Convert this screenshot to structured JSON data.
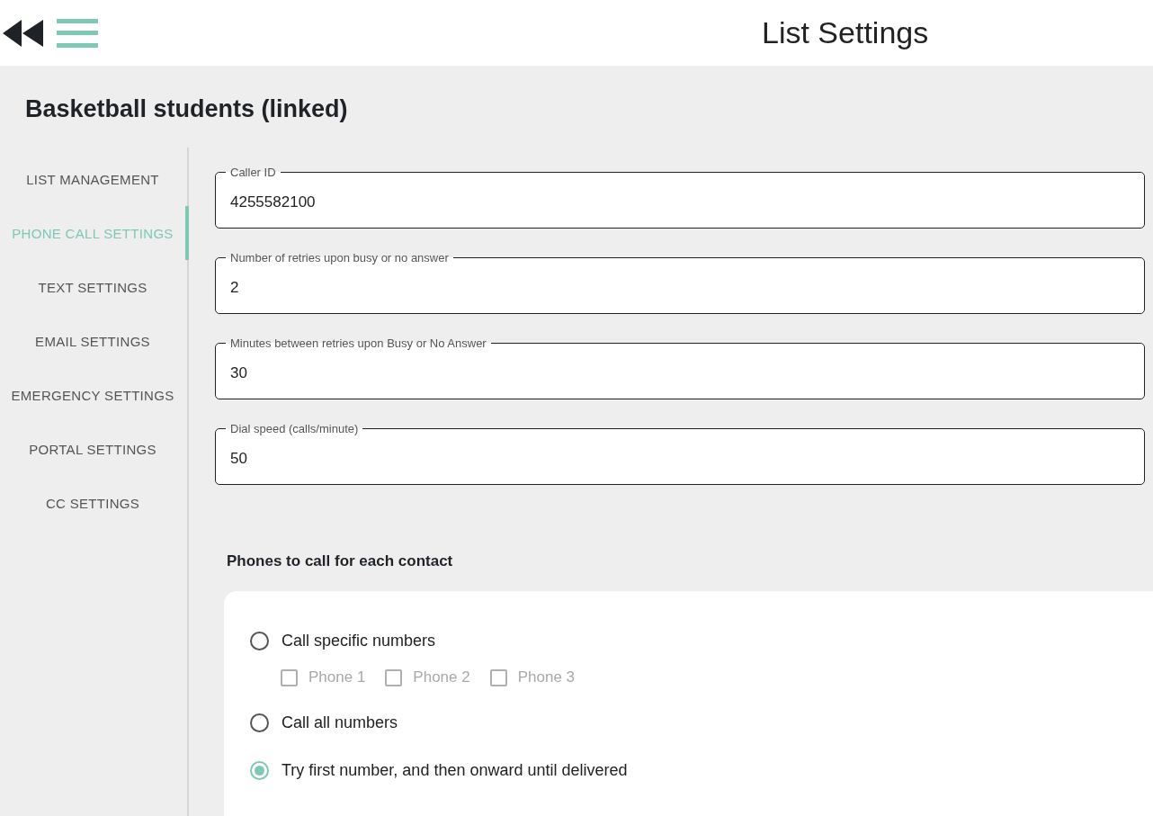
{
  "header": {
    "title": "List Settings"
  },
  "list_title": "Basketball students (linked)",
  "sidebar": {
    "items": [
      {
        "label": "LIST MANAGEMENT",
        "selected": false
      },
      {
        "label": "PHONE CALL SETTINGS",
        "selected": true
      },
      {
        "label": "TEXT SETTINGS",
        "selected": false
      },
      {
        "label": "EMAIL SETTINGS",
        "selected": false
      },
      {
        "label": "EMERGENCY SETTINGS",
        "selected": false
      },
      {
        "label": "PORTAL SETTINGS",
        "selected": false
      },
      {
        "label": "CC SETTINGS",
        "selected": false
      }
    ]
  },
  "fields": [
    {
      "label": "Caller ID",
      "value": "4255582100"
    },
    {
      "label": "Number of retries upon busy or no answer",
      "value": "2"
    },
    {
      "label": "Minutes between retries upon Busy or No Answer",
      "value": "30"
    },
    {
      "label": "Dial speed (calls/minute)",
      "value": "50"
    }
  ],
  "phones_section": {
    "heading": "Phones to call for each contact",
    "options": [
      {
        "label": "Call specific numbers",
        "selected": false,
        "checkboxes": [
          {
            "label": "Phone 1",
            "checked": false,
            "disabled": true
          },
          {
            "label": "Phone 2",
            "checked": false,
            "disabled": true
          },
          {
            "label": "Phone 3",
            "checked": false,
            "disabled": true
          }
        ]
      },
      {
        "label": "Call all numbers",
        "selected": false
      },
      {
        "label": "Try first number, and then onward until delivered",
        "selected": true
      }
    ]
  }
}
